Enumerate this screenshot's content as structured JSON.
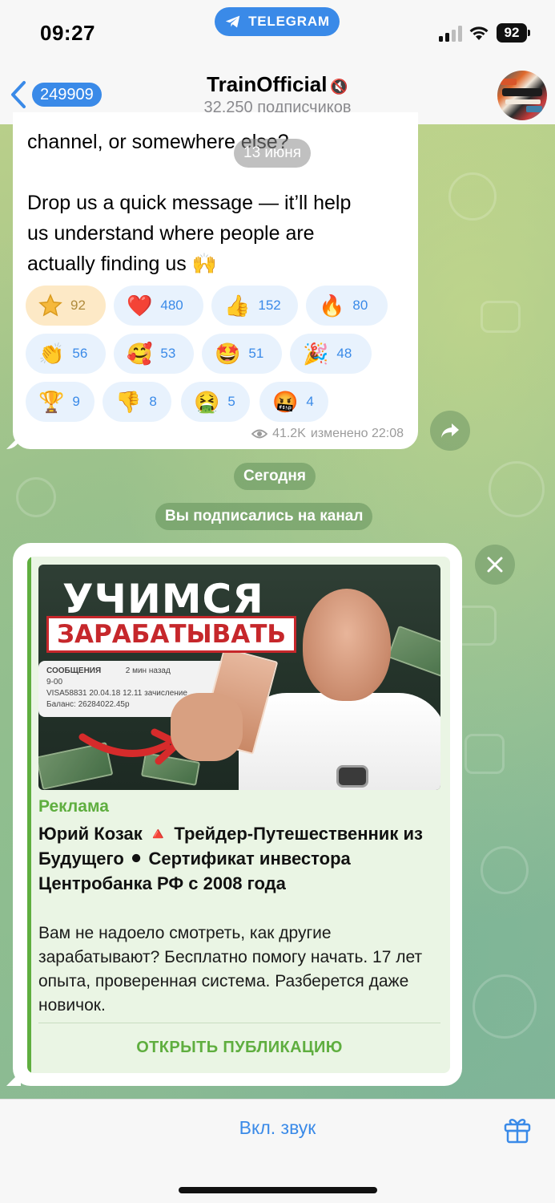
{
  "status_bar": {
    "time": "09:27",
    "app_pill": "TELEGRAM",
    "battery": "92"
  },
  "header": {
    "back_count": "249909",
    "title": "TrainOfficial",
    "mute_icon": "🔇",
    "subtitle": "32,250 подписчиков"
  },
  "message": {
    "line1": "channel, or somewhere else?",
    "line2": "Drop us a quick message — it’ll help",
    "line3": "us understand where people are",
    "line4": "actually finding us 🙌",
    "date_pill": "13 июня",
    "reactions": [
      {
        "emoji": "⭐",
        "count": "92",
        "kind": "paid-star"
      },
      {
        "emoji": "❤️",
        "count": "480"
      },
      {
        "emoji": "👍",
        "count": "152"
      },
      {
        "emoji": "🔥",
        "count": "80"
      },
      {
        "emoji": "👏",
        "count": "56"
      },
      {
        "emoji": "🥰",
        "count": "53"
      },
      {
        "emoji": "🤩",
        "count": "51"
      },
      {
        "emoji": "🎉",
        "count": "48"
      },
      {
        "emoji": "🏆",
        "count": "9"
      },
      {
        "emoji": "👎",
        "count": "8"
      },
      {
        "emoji": "🤮",
        "count": "5"
      },
      {
        "emoji": "🤬",
        "count": "4"
      }
    ],
    "views": "41.2K",
    "edited_time": "изменено 22:08"
  },
  "service": {
    "today": "Сегодня",
    "subscribed": "Вы подписались на канал"
  },
  "ad": {
    "image_headline_1": "УЧИМСЯ",
    "image_headline_2": "ЗАРАБАТЫВАТЬ",
    "phone_line1": "СООБЩЕНИЯ",
    "phone_time": "2 мин назад",
    "phone_line2": "9-00",
    "phone_line3": "VISA58831 20.04.18 12.11 зачисление",
    "phone_line4": "Баланс: 26284022.45р",
    "label": "Реклама",
    "title": "Юрий Козак 🔺 Трейдер-Путешественник из Будущего ⚫ Сертификат инвестора Центробанка РФ с 2008 года",
    "description": "Вам не надоело смотреть, как другие зарабатывают? Бесплатно помогу начать. 17 лет опыта, проверенная система. Разберется даже новичок.",
    "cta": "ОТКРЫТЬ ПУБЛИКАЦИЮ"
  },
  "bottom": {
    "unmute": "Вкл. звук"
  },
  "colors": {
    "accent": "#3a8ae8",
    "ad_green": "#5fae3f",
    "reaction_bg": "#e8f2fd"
  }
}
